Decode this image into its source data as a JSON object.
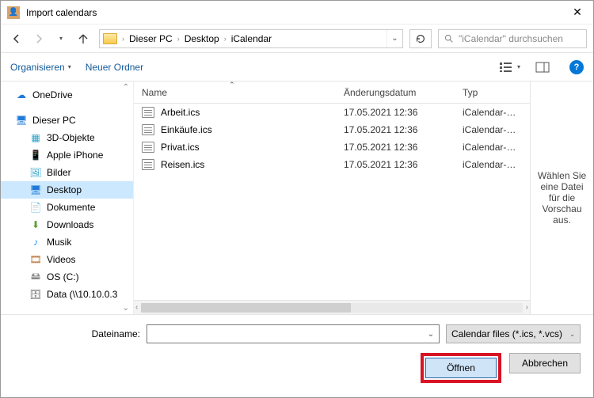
{
  "window": {
    "title": "Import calendars"
  },
  "nav": {
    "crumbs": [
      "Dieser PC",
      "Desktop",
      "iCalendar"
    ],
    "search_placeholder": "\"iCalendar\" durchsuchen"
  },
  "toolbar": {
    "organize": "Organisieren",
    "new_folder": "Neuer Ordner"
  },
  "sidebar": {
    "onedrive": "OneDrive",
    "this_pc": "Dieser PC",
    "items": [
      {
        "label": "3D-Objekte",
        "ico": "obj"
      },
      {
        "label": "Apple iPhone",
        "ico": "phone"
      },
      {
        "label": "Bilder",
        "ico": "pics"
      },
      {
        "label": "Desktop",
        "ico": "desk",
        "selected": true
      },
      {
        "label": "Dokumente",
        "ico": "docs"
      },
      {
        "label": "Downloads",
        "ico": "down"
      },
      {
        "label": "Musik",
        "ico": "music"
      },
      {
        "label": "Videos",
        "ico": "vid"
      },
      {
        "label": "OS (C:)",
        "ico": "drive"
      },
      {
        "label": "Data (\\\\10.10.0.3",
        "ico": "data"
      }
    ]
  },
  "columns": {
    "name": "Name",
    "date": "Änderungsdatum",
    "type": "Typ"
  },
  "files": [
    {
      "name": "Arbeit.ics",
      "date": "17.05.2021 12:36",
      "type": "iCalendar-Datei"
    },
    {
      "name": "Einkäufe.ics",
      "date": "17.05.2021 12:36",
      "type": "iCalendar-Datei"
    },
    {
      "name": "Privat.ics",
      "date": "17.05.2021 12:36",
      "type": "iCalendar-Datei"
    },
    {
      "name": "Reisen.ics",
      "date": "17.05.2021 12:36",
      "type": "iCalendar-Datei"
    }
  ],
  "preview": {
    "text": "Wählen Sie eine Datei für die Vorschau aus."
  },
  "footer": {
    "filename_label": "Dateiname:",
    "filename_value": "",
    "type_filter": "Calendar files (*.ics, *.vcs)",
    "open": "Öffnen",
    "cancel": "Abbrechen"
  }
}
